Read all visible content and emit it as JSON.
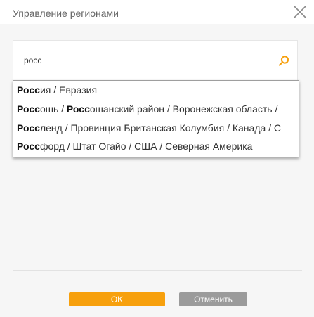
{
  "dialog": {
    "title": "Управление регионами"
  },
  "search": {
    "value": "росс"
  },
  "suggestions": [
    {
      "match": "Росс",
      "rest": "ия / Евразия",
      "match2": "",
      "rest2": ""
    },
    {
      "match": "Росс",
      "rest": "ошь / ",
      "match2": "Росс",
      "rest2": "ошанский район / Воронежская область / "
    },
    {
      "match": "Росс",
      "rest": "ленд / Провинция Британская Колумбия / Канада / С",
      "match2": "",
      "rest2": ""
    },
    {
      "match": "Росс",
      "rest": "форд / Штат Огайо / США / Северная Америка",
      "match2": "",
      "rest2": ""
    }
  ],
  "buttons": {
    "ok": "OK",
    "cancel": "Отменить"
  },
  "colors": {
    "accent": "#f7a00d",
    "cancel": "#9b9b9b",
    "background": "#f6f6f6"
  },
  "icons": {
    "close": "close-icon",
    "search": "search-icon"
  }
}
